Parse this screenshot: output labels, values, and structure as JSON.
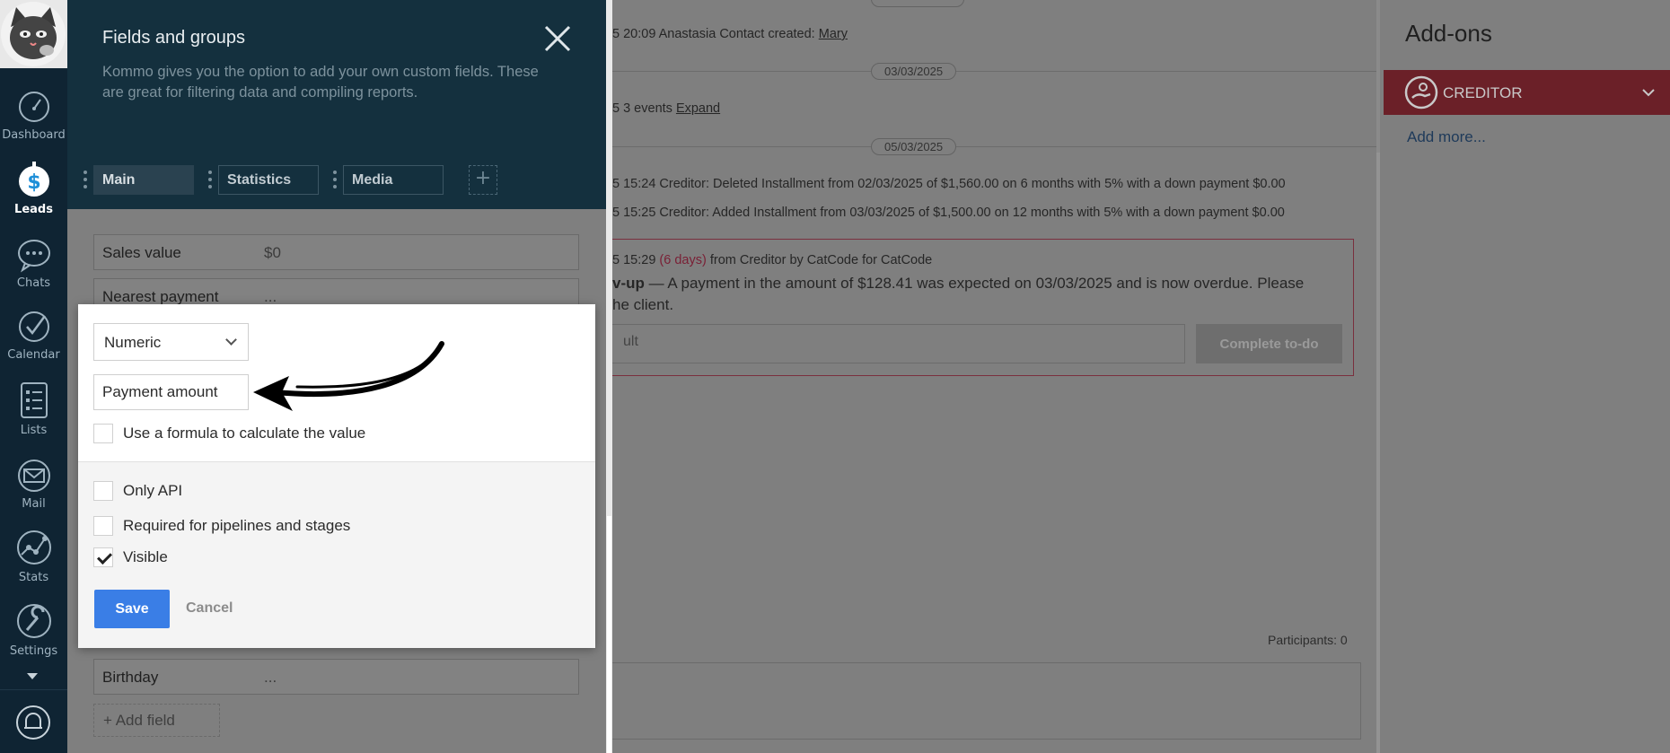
{
  "nav": {
    "items": [
      {
        "label": "Dashboard",
        "icon": "dashboard-icon"
      },
      {
        "label": "Leads",
        "icon": "leads-icon",
        "active": true
      },
      {
        "label": "Chats",
        "icon": "chats-icon"
      },
      {
        "label": "Calendar",
        "icon": "calendar-icon"
      },
      {
        "label": "Lists",
        "icon": "lists-icon"
      },
      {
        "label": "Mail",
        "icon": "mail-icon"
      },
      {
        "label": "Stats",
        "icon": "stats-icon"
      },
      {
        "label": "Settings",
        "icon": "settings-icon"
      }
    ]
  },
  "fields_panel": {
    "title": "Fields and groups",
    "description": "Kommo gives you the option to add your own custom fields. These are great for filtering data and compiling reports.",
    "tabs": [
      "Main",
      "Statistics",
      "Media"
    ],
    "fields": [
      {
        "name": "Sales value",
        "value": "$0"
      },
      {
        "name": "Nearest payment",
        "value": "..."
      },
      {
        "name": "Birthday",
        "value": "..."
      }
    ],
    "add_field_label": "Add field"
  },
  "modal": {
    "type_value": "Numeric",
    "name_value": "Payment amount",
    "formula_label": "Use a formula to calculate the value",
    "only_api_label": "Only API",
    "required_label": "Required for pipelines and stages",
    "visible_label": "Visible",
    "visible_checked": true,
    "save_label": "Save",
    "cancel_label": "Cancel"
  },
  "feed": {
    "pill_1": "03/03/2025",
    "pill_2": "05/03/2025",
    "line_1_prefix": "5 20:09 Anastasia Contact created: ",
    "line_1_link": "Mary",
    "line_2_prefix": "5 3 events ",
    "line_2_link": "Expand",
    "line_3": "5 15:24 Creditor: Deleted Installment from 02/03/2025 of $1,560.00 on 6 months with 5% with a down payment $0.00",
    "line_4": "5 15:25 Creditor: Added Installment from 03/03/2025 of $1,500.00 on 12 months with 5% with a down payment $0.00",
    "task_time": "5 15:29 ",
    "task_overdue": "(6 days)",
    "task_from": " from Creditor by CatCode for CatCode",
    "task_type": "v-up",
    "task_text": " — A payment in the amount of $128.41 was expected on 03/03/2025 and is now overdue. Please",
    "task_text_2": "he client.",
    "task_input_value": "ult",
    "complete_label": "Complete to-do",
    "participants": "Participants: 0"
  },
  "addons": {
    "title": "Add-ons",
    "creditor_label": "CREDITOR",
    "add_more_label": "Add more..."
  }
}
